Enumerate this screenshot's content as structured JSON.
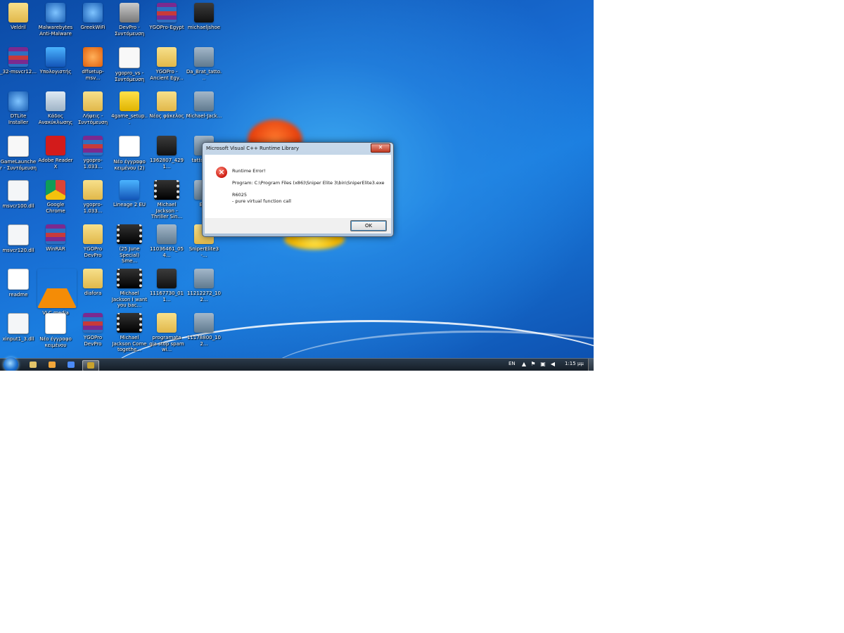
{
  "desktop_icons": [
    {
      "label": "Veldril",
      "type": "folder"
    },
    {
      "label": "Malwarebytes Anti-Malware",
      "type": "blue"
    },
    {
      "label": "GreekWiFi",
      "type": "blue"
    },
    {
      "label": "DevPro - Συντόμευση",
      "type": "gray"
    },
    {
      "label": "YGOPro-Egypt",
      "type": "rar"
    },
    {
      "label": "michaeljshoe",
      "type": "dark"
    },
    {
      "label": "_32-msvcr12...",
      "type": "rar"
    },
    {
      "label": "Υπολογιστής",
      "type": "cyan"
    },
    {
      "label": "dffsetup-msv...",
      "type": "orange"
    },
    {
      "label": "ygopro_vs - Συντόμευση",
      "type": "white"
    },
    {
      "label": "YGOPro - Ancient Egy...",
      "type": "folder"
    },
    {
      "label": "Da_Brat_tatto...",
      "type": "photo"
    },
    {
      "label": "DTLite Installer",
      "type": "blue"
    },
    {
      "label": "Κάδος Ανακύκλωσης",
      "type": "trash"
    },
    {
      "label": "Λήψεις - Συντόμευση",
      "type": "folder"
    },
    {
      "label": "4game_setup...",
      "type": "yellow"
    },
    {
      "label": "Νέος φάκελος",
      "type": "folder"
    },
    {
      "label": "Michael-Jack...",
      "type": "photo"
    },
    {
      "label": "GameLauncher - Συντόμευση",
      "type": "white"
    },
    {
      "label": "Adobe Reader X",
      "type": "red"
    },
    {
      "label": "ygopro-1.033...",
      "type": "rar"
    },
    {
      "label": "Νέο έγγραφο κειμένου (2)",
      "type": "doc"
    },
    {
      "label": "1362807_4291...",
      "type": "dark"
    },
    {
      "label": "tatto-mi...",
      "type": "photo"
    },
    {
      "label": "msvcr100.dll",
      "type": "dll"
    },
    {
      "label": "Google Chrome",
      "type": "chrome"
    },
    {
      "label": "ygopro-1.033...",
      "type": "folder"
    },
    {
      "label": "Lineage 2 EU",
      "type": "cyan"
    },
    {
      "label": "Michael Jackson - Thriller Sin...",
      "type": "film"
    },
    {
      "label": "Ei...",
      "type": "photo"
    },
    {
      "label": "msvcr120.dll",
      "type": "dll"
    },
    {
      "label": "WinRAR",
      "type": "rar"
    },
    {
      "label": "YGOPro DevPro",
      "type": "folder"
    },
    {
      "label": "(25 June Special) Sme...",
      "type": "film"
    },
    {
      "label": "11036461_054...",
      "type": "photo"
    },
    {
      "label": "SniperElite3 -...",
      "type": "folder"
    },
    {
      "label": "readme",
      "type": "doc"
    },
    {
      "label": "VLC media player",
      "type": "vlc"
    },
    {
      "label": "diafora",
      "type": "folder"
    },
    {
      "label": "Michael Jackson I want you bac...",
      "type": "film"
    },
    {
      "label": "11167730_011...",
      "type": "dark"
    },
    {
      "label": "11212272_102...",
      "type": "photo"
    },
    {
      "label": "xinput1_3.dll",
      "type": "dll"
    },
    {
      "label": "Νέο έγγραφο κειμένου",
      "type": "doc"
    },
    {
      "label": "YGOPro DevPro",
      "type": "rar"
    },
    {
      "label": "Michael Jackson Come togethe...",
      "type": "film"
    },
    {
      "label": "programata gia stop spam wi...",
      "type": "folder"
    },
    {
      "label": "11178800_102...",
      "type": "photo"
    }
  ],
  "dialog": {
    "title": "Microsoft Visual C++ Runtime Library",
    "close_label": "✕",
    "heading": "Runtime Error!",
    "program_line": "Program: C:\\Program Files (x86)\\Sniper Elite 3\\bin\\SniperElite3.exe",
    "code": "R6025",
    "detail": "- pure virtual function call",
    "ok_label": "OK"
  },
  "taskbar": {
    "pinned": [
      {
        "name": "explorer",
        "color": "#e2c46a"
      },
      {
        "name": "media-player",
        "color": "#f2a73a"
      },
      {
        "name": "chrome",
        "color": "#4c8bf5"
      },
      {
        "name": "winrar",
        "color": "#c9a22c",
        "active": true
      }
    ],
    "language": "EN",
    "clock": "1:15 μμ"
  },
  "colors": {
    "accent": "#1769cf",
    "error_red": "#cc1a10"
  }
}
